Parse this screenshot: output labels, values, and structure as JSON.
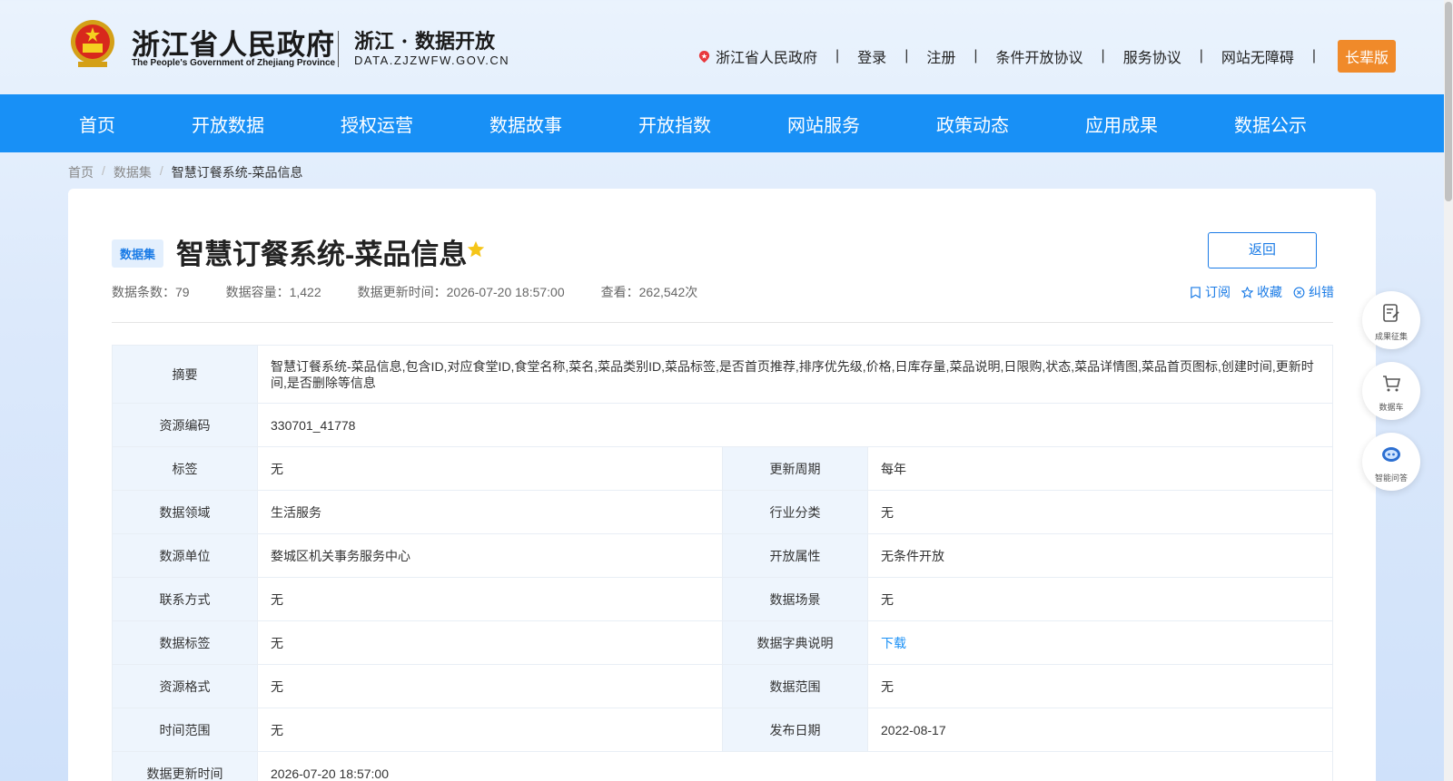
{
  "header": {
    "gov_title": "浙江省人民政府",
    "gov_subtitle": "The People's Government of Zhejiang Province",
    "portal_title": "浙江 · 数据开放",
    "portal_domain": "DATA.ZJZWFW.GOV.CN",
    "links": [
      "浙江省人民政府",
      "登录",
      "注册",
      "条件开放协议",
      "服务协议",
      "网站无障碍"
    ],
    "separator": "|",
    "elder_button": "长辈版"
  },
  "nav": [
    "首页",
    "开放数据",
    "授权运营",
    "数据故事",
    "开放指数",
    "网站服务",
    "政策动态",
    "应用成果",
    "数据公示"
  ],
  "breadcrumb": {
    "items": [
      "首页",
      "数据集"
    ],
    "current": "智慧订餐系统-菜品信息",
    "separator": "/"
  },
  "dataset": {
    "badge": "数据集",
    "title": "智慧订餐系统-菜品信息",
    "back_button": "返回",
    "meta": {
      "records": "数据条数：79",
      "capacity": "数据容量：1,422",
      "updated": "数据更新时间：2026-07-20 18:57:00",
      "views": "查看：262,542次"
    },
    "actions": {
      "subscribe": "订阅",
      "favorite": "收藏",
      "correct": "纠错"
    }
  },
  "table": {
    "summary_label": "摘要",
    "summary_value": "智慧订餐系统-菜品信息,包含ID,对应食堂ID,食堂名称,菜名,菜品类别ID,菜品标签,是否首页推荐,排序优先级,价格,日库存量,菜品说明,日限购,状态,菜品详情图,菜品首页图标,创建时间,更新时间,是否删除等信息",
    "code_label": "资源编码",
    "code_value": "330701_41778",
    "rows": [
      {
        "l1": "标签",
        "v1": "无",
        "l2": "更新周期",
        "v2": "每年"
      },
      {
        "l1": "数据领域",
        "v1": "生活服务",
        "l2": "行业分类",
        "v2": "无"
      },
      {
        "l1": "数源单位",
        "v1": "婺城区机关事务服务中心",
        "l2": "开放属性",
        "v2": "无条件开放"
      },
      {
        "l1": "联系方式",
        "v1": "无",
        "l2": "数据场景",
        "v2": "无"
      },
      {
        "l1": "数据标签",
        "v1": "无",
        "l2": "数据字典说明",
        "v2": "下载"
      },
      {
        "l1": "资源格式",
        "v1": "无",
        "l2": "数据范围",
        "v2": "无"
      },
      {
        "l1": "时间范围",
        "v1": "无",
        "l2": "发布日期",
        "v2": "2022-08-17"
      }
    ],
    "last_label": "数据更新时间",
    "last_value": "2026-07-20 18:57:00"
  },
  "side_buttons": [
    "成果征集",
    "数据车",
    "智能问答"
  ],
  "colors": {
    "nav": "#1890f6",
    "accent": "#1a7be6",
    "elder": "#f08a2a",
    "star": "#f5c518"
  }
}
